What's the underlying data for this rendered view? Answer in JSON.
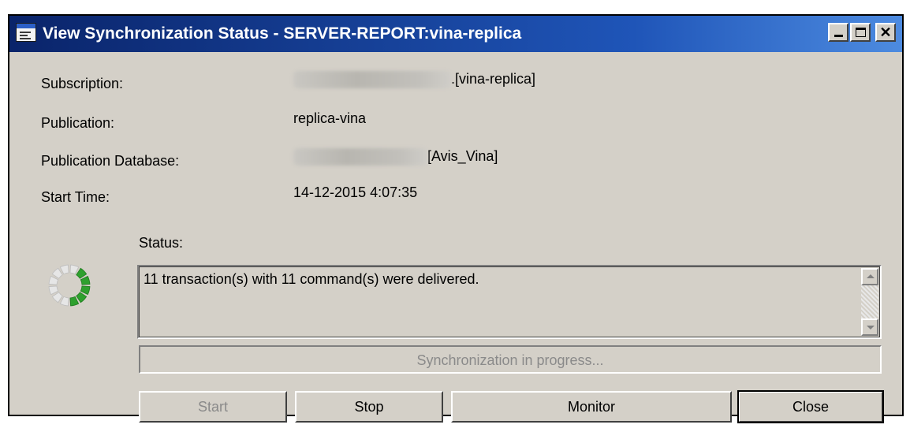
{
  "window": {
    "title": "View Synchronization Status - SERVER-REPORT:vina-replica",
    "controls": {
      "minimize": "minimize",
      "maximize": "maximize",
      "close": "✕"
    }
  },
  "fields": {
    "subscription": {
      "label": "Subscription:",
      "value_suffix": ".[vina-replica]"
    },
    "publication": {
      "label": "Publication:",
      "value": "replica-vina"
    },
    "publication_database": {
      "label": "Publication Database:",
      "value_suffix": "[Avis_Vina]"
    },
    "start_time": {
      "label": "Start Time:",
      "value": "14-12-2015 4:07:35"
    }
  },
  "status": {
    "label": "Status:",
    "message": "11 transaction(s) with 11 command(s) were delivered."
  },
  "progress": {
    "text": "Synchronization in progress..."
  },
  "buttons": {
    "start": "Start",
    "stop": "Stop",
    "monitor": "Monitor",
    "close": "Close"
  },
  "colors": {
    "spinner_active": "#2ea02e",
    "spinner_inactive": "#e6e6e6",
    "title_bar": "#0a246a"
  }
}
